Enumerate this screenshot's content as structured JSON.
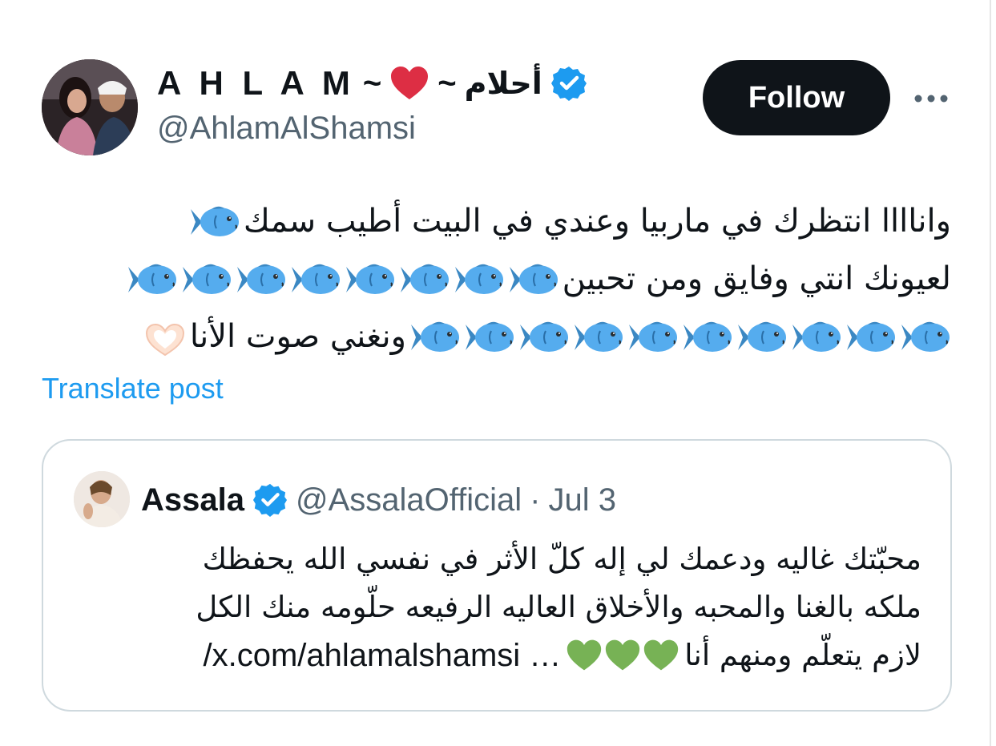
{
  "author": {
    "display_name": "A H L A M",
    "name_sep_left": "~",
    "name_sep_right": "~",
    "name_arabic": "أحلام",
    "handle": "@AhlamAlShamsi",
    "heart_icon": "red-heart-icon",
    "verified_icon": "verified-badge-icon"
  },
  "actions": {
    "follow_label": "Follow",
    "more_icon": "more-horizontal-icon"
  },
  "tweet": {
    "line1_text": "واناااا انتظرك في ماربيا وعندي في البيت أطيب سمك",
    "line1_fish_count": 1,
    "line2_text": "لعيونك انتي وفايق ومن تحبين",
    "line2_fish_count": 8,
    "line3_text": "ونغني صوت الأنا",
    "line3_fish_count": 10,
    "fish_icon": "fish-emoji-icon",
    "hands_icon": "heart-hands-emoji-icon"
  },
  "translate_label": "Translate post",
  "quote": {
    "name": "Assala",
    "handle": "@AssalaOfficial",
    "separator": "·",
    "date": "Jul 3",
    "line1": "محبّتك غاليه ودعمك لي إله كلّ الأثر في نفسي الله يحفظك",
    "line2": "ملكه بالغنا والمحبه والأخلاق العاليه الرفيعه حلّومه منك الكل",
    "line3_text": "لازم يتعلّم ومنهم أنا",
    "line3_link": "/x.com/ahlamalshamsi …",
    "green_heart_count": 3,
    "green_heart_icon": "green-heart-emoji-icon"
  },
  "colors": {
    "text_primary": "#0f1419",
    "text_secondary": "#536471",
    "link_blue": "#1d9bf0",
    "follow_bg": "#0f1419",
    "card_border": "#cfd9de"
  }
}
